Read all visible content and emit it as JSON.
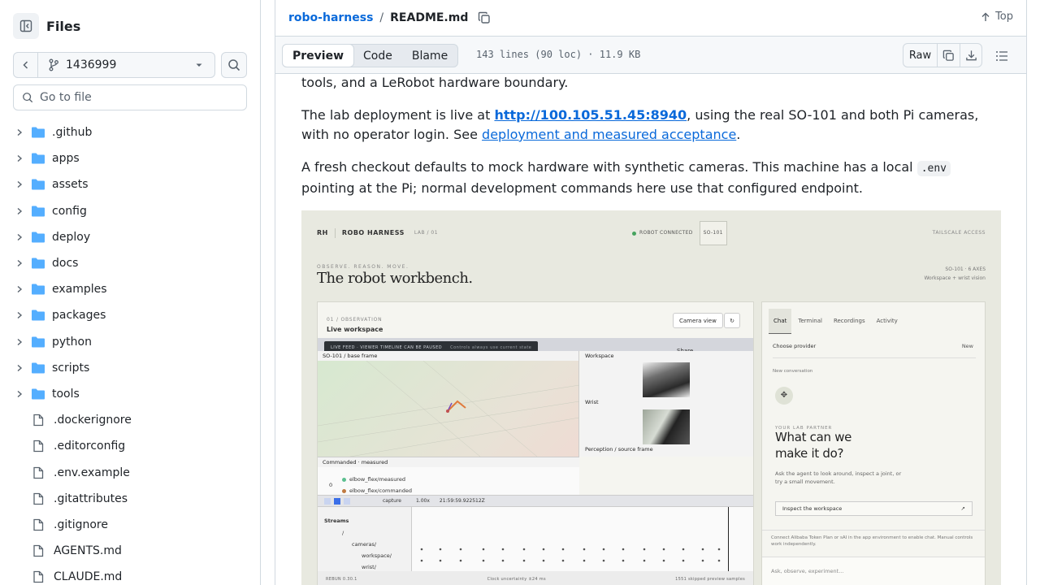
{
  "sidebar": {
    "title": "Files",
    "branch": "1436999",
    "goto_placeholder": "Go to file",
    "folders": [
      ".github",
      "apps",
      "assets",
      "config",
      "deploy",
      "docs",
      "examples",
      "packages",
      "python",
      "scripts",
      "tools"
    ],
    "files": [
      ".dockerignore",
      ".editorconfig",
      ".env.example",
      ".gitattributes",
      ".gitignore",
      "AGENTS.md",
      "CLAUDE.md"
    ]
  },
  "header": {
    "repo": "robo-harness",
    "separator": "/",
    "file": "README.md",
    "top_label": "Top"
  },
  "toolbar": {
    "tabs": [
      "Preview",
      "Code",
      "Blame"
    ],
    "active_tab": "Preview",
    "meta": "143 lines (90 loc) · 11.9 KB",
    "raw_label": "Raw"
  },
  "readme": {
    "p1": "tools, and a LeRobot hardware boundary.",
    "p2_a": "The lab deployment is live at ",
    "p2_link": "http://100.105.51.45:8940",
    "p2_b": ", using the real SO-101 and both Pi cameras, with no operator login. See ",
    "p2_link2": "deployment and measured acceptance",
    "p2_c": ".",
    "p3_a": "A fresh checkout defaults to mock hardware with synthetic cameras. This machine has a local ",
    "p3_code": ".env",
    "p3_b": " pointing at the Pi; normal development commands here use that configured endpoint."
  },
  "screenshot": {
    "rh": "RH",
    "brand": "ROBO HARNESS",
    "lab": "LAB / 01",
    "status": "ROBOT CONNECTED",
    "badge": "SO-101",
    "access": "TAILSCALE ACCESS",
    "kicker": "OBSERVE. REASON. MOVE.",
    "headline": "The robot workbench.",
    "meta1": "SO-101 · 6 AXES",
    "meta2": "Workspace + wrist vision",
    "obs_kicker": "01 / OBSERVATION",
    "obs_title": "Live workspace",
    "camera_view": "Camera view",
    "refresh": "↻",
    "banner_a": "LIVE FEED · VIEWER TIMELINE CAN BE PAUSED",
    "banner_b": "Controls always use current state",
    "share": "Share",
    "view_3d": "SO-101 / base frame",
    "view_workspace": "Workspace",
    "view_wrist": "Wrist",
    "view_perception": "Perception / source frame",
    "plot_title": "Commanded · measured",
    "series1": "elbow_flex/measured",
    "series2": "elbow_flex/commanded",
    "plot_zero": "0",
    "capture": "capture",
    "speed": "1.00x",
    "time": "21:59:59.922512Z",
    "streams": "Streams",
    "stream_root": "/",
    "stream_cameras": "cameras/",
    "stream_workspace": "workspace/",
    "stream_wrist": "wrist/",
    "foot_a": "REBUN 0.30.1",
    "foot_b": "Clock uncertainty ±24 ms",
    "foot_c": "1551 skipped preview samples",
    "tabs": [
      "Chat",
      "Terminal",
      "Recordings",
      "Activity"
    ],
    "provider": "Choose provider",
    "new": "New",
    "new_conv": "New conversation",
    "partner_kicker": "YOUR LAB PARTNER",
    "partner_h1": "What can we",
    "partner_h2": "make it do?",
    "partner_sub": "Ask the agent to look around, inspect a joint, or try a small movement.",
    "inspect": "Inspect the workspace",
    "connect": "Connect Alibaba Token Plan or sAI in the app environment to enable chat. Manual controls work independently.",
    "ask_placeholder": "Ask, observe, experiment..."
  },
  "colors": {
    "link": "#0969da",
    "folder": "#54aeff",
    "border": "#d1d9e0"
  }
}
